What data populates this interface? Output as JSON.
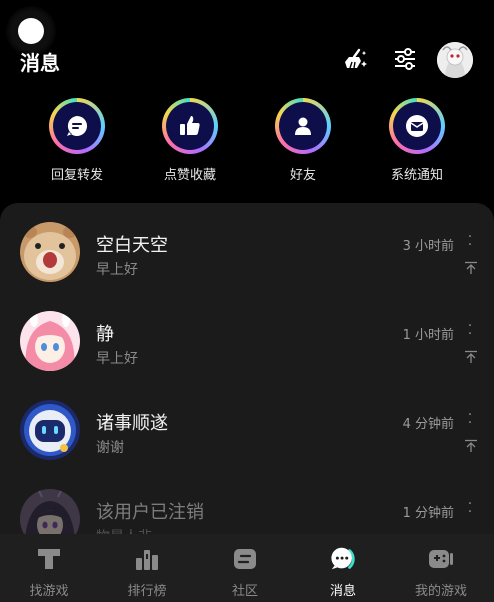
{
  "header": {
    "title": "消息",
    "icons": [
      "float-assist-icon",
      "broom-sparkle-icon",
      "filter-sliders-icon",
      "user-avatar"
    ]
  },
  "quick_actions": [
    {
      "label": "回复转发",
      "icon": "chat-bubble-icon"
    },
    {
      "label": "点赞收藏",
      "icon": "thumbs-up-icon"
    },
    {
      "label": "好友",
      "icon": "person-icon"
    },
    {
      "label": "系统通知",
      "icon": "envelope-icon"
    }
  ],
  "messages": [
    {
      "name": "空白天空",
      "preview": "早上好",
      "time": "3 小时前",
      "avatar": "hamster-avatar"
    },
    {
      "name": "静",
      "preview": "早上好",
      "time": "1 小时前",
      "avatar": "anime-girl-avatar"
    },
    {
      "name": "诸事顺遂",
      "preview": "谢谢",
      "time": "4 分钟前",
      "avatar": "robot-avatar"
    },
    {
      "name": "该用户已注销",
      "preview": "物是人非",
      "time": "1 分钟前",
      "avatar": "anime-character-avatar"
    }
  ],
  "tabs": [
    {
      "label": "找游戏",
      "icon": "t-block-icon",
      "active": false
    },
    {
      "label": "排行榜",
      "icon": "podium-icon",
      "active": false
    },
    {
      "label": "社区",
      "icon": "community-card-icon",
      "active": false
    },
    {
      "label": "消息",
      "icon": "message-bubble-icon",
      "active": true
    },
    {
      "label": "我的游戏",
      "icon": "gamepad-icon",
      "active": false
    }
  ],
  "colors": {
    "background": "#000000",
    "panel": "#1b1b1b",
    "tabbar": "#1f1f1f",
    "quick_inner": "#0e0f4a",
    "active_accent": "#3de0c9"
  }
}
